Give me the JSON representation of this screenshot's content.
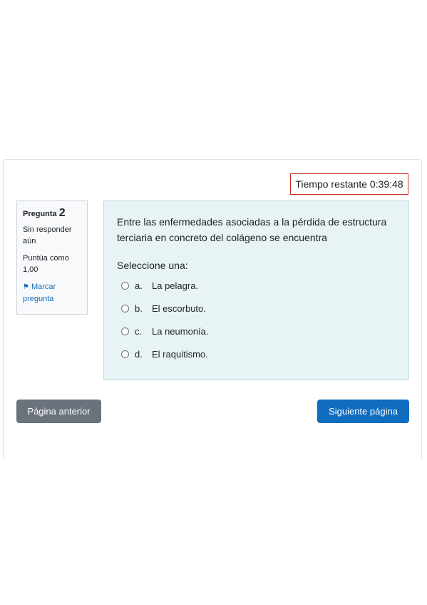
{
  "timer": {
    "label": "Tiempo restante 0:39:48"
  },
  "question_info": {
    "label": "Pregunta",
    "number": "2",
    "state": "Sin responder aún",
    "grade": "Puntúa como 1,00",
    "flag_label": "Marcar pregunta",
    "flag_icon": "flag-icon"
  },
  "question": {
    "text": "Entre las enfermedades asociadas a la pérdida de estructura terciaria en concreto del colágeno se encuentra",
    "prompt": "Seleccione una:",
    "options": [
      {
        "letter": "a.",
        "text": "La pelagra."
      },
      {
        "letter": "b.",
        "text": "El escorbuto."
      },
      {
        "letter": "c.",
        "text": "La neumonía."
      },
      {
        "letter": "d.",
        "text": "El raquitismo."
      }
    ]
  },
  "navigation": {
    "prev_label": "Página anterior",
    "next_label": "Siguiente página"
  },
  "colors": {
    "primary": "#0f6cbf",
    "secondary": "#6a737b",
    "timer_border": "#ca3120",
    "question_bg": "#e7f3f5"
  }
}
